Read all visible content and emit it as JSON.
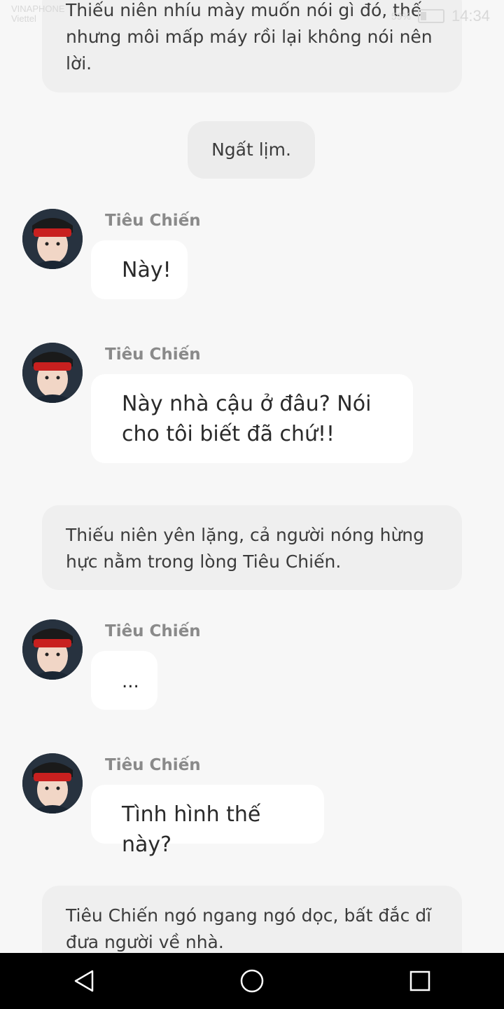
{
  "status_bar": {
    "carrier_line1": "VINAPHONE",
    "carrier_line2": "Viettel",
    "battery": "59%",
    "time": "14:34"
  },
  "messages": [
    {
      "type": "narration",
      "text": "Thiếu niên nhíu mày muốn nói gì đó, thế nhưng môi mấp máy rồi lại không nói nên lời."
    },
    {
      "type": "center",
      "text": "Ngất lịm."
    },
    {
      "type": "chat",
      "sender": "Tiêu Chiến",
      "text": "Này!"
    },
    {
      "type": "chat",
      "sender": "Tiêu Chiến",
      "text": "Này nhà cậu ở đâu? Nói cho tôi biết đã chứ!!"
    },
    {
      "type": "narration",
      "text": "Thiếu niên yên lặng, cả người nóng hừng hực nằm trong lòng Tiêu Chiến."
    },
    {
      "type": "chat",
      "sender": "Tiêu Chiến",
      "text": "..."
    },
    {
      "type": "chat",
      "sender": "Tiêu Chiến",
      "text": "Tình hình thế này?"
    },
    {
      "type": "narration",
      "text": "Tiêu Chiến ngó ngang ngó dọc, bất đắc dĩ đưa người về nhà."
    }
  ],
  "nav": {
    "back_icon": "triangle-back-icon",
    "home_icon": "circle-home-icon",
    "recents_icon": "square-recents-icon"
  }
}
